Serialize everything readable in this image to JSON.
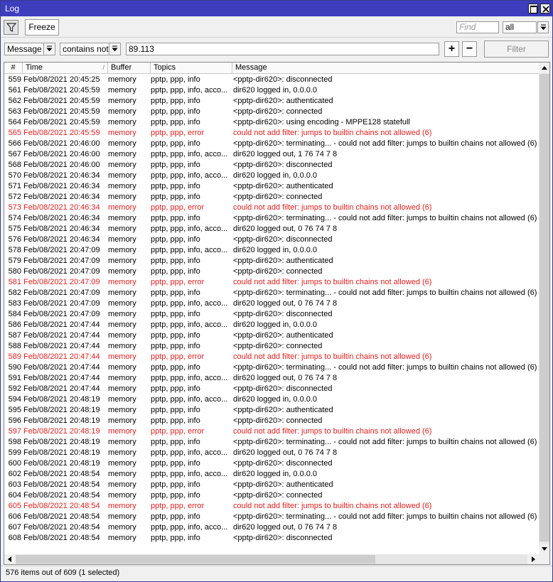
{
  "window": {
    "title": "Log"
  },
  "toolbar": {
    "freeze_label": "Freeze",
    "find_placeholder": "Find",
    "all_value": "all"
  },
  "filter": {
    "field": "Message",
    "operator": "contains not",
    "value": "89.113",
    "add_label": "+",
    "remove_label": "−",
    "filter_label": "Filter"
  },
  "columns": [
    "#",
    "Time",
    "Buffer",
    "Topics",
    "Message"
  ],
  "colors": {
    "error": "#e02020",
    "titlebar": "#3d3dbd"
  },
  "rows": [
    {
      "num": "559",
      "time": "Feb/08/2021 20:45:25",
      "buffer": "memory",
      "topics": "pptp, ppp, info",
      "message": "<pptp-dir620>: disconnected",
      "error": false
    },
    {
      "num": "561",
      "time": "Feb/08/2021 20:45:59",
      "buffer": "memory",
      "topics": "pptp, ppp, info, acco...",
      "message": "dir620 logged in, 0.0.0.0",
      "error": false
    },
    {
      "num": "562",
      "time": "Feb/08/2021 20:45:59",
      "buffer": "memory",
      "topics": "pptp, ppp, info",
      "message": "<pptp-dir620>: authenticated",
      "error": false
    },
    {
      "num": "563",
      "time": "Feb/08/2021 20:45:59",
      "buffer": "memory",
      "topics": "pptp, ppp, info",
      "message": "<pptp-dir620>: connected",
      "error": false
    },
    {
      "num": "564",
      "time": "Feb/08/2021 20:45:59",
      "buffer": "memory",
      "topics": "pptp, ppp, info",
      "message": "<pptp-dir620>: using encoding - MPPE128 statefull",
      "error": false
    },
    {
      "num": "565",
      "time": "Feb/08/2021 20:45:59",
      "buffer": "memory",
      "topics": "pptp, ppp, error",
      "message": "could not add filter: jumps to builtin chains not allowed (6)",
      "error": true
    },
    {
      "num": "566",
      "time": "Feb/08/2021 20:46:00",
      "buffer": "memory",
      "topics": "pptp, ppp, info",
      "message": "<pptp-dir620>: terminating... - could not add filter: jumps to builtin chains not allowed (6)",
      "error": false
    },
    {
      "num": "567",
      "time": "Feb/08/2021 20:46:00",
      "buffer": "memory",
      "topics": "pptp, ppp, info, acco...",
      "message": "dir620 logged out, 1 76 74 7 8",
      "error": false
    },
    {
      "num": "568",
      "time": "Feb/08/2021 20:46:00",
      "buffer": "memory",
      "topics": "pptp, ppp, info",
      "message": "<pptp-dir620>: disconnected",
      "error": false
    },
    {
      "num": "570",
      "time": "Feb/08/2021 20:46:34",
      "buffer": "memory",
      "topics": "pptp, ppp, info, acco...",
      "message": "dir620 logged in, 0.0.0.0",
      "error": false
    },
    {
      "num": "571",
      "time": "Feb/08/2021 20:46:34",
      "buffer": "memory",
      "topics": "pptp, ppp, info",
      "message": "<pptp-dir620>: authenticated",
      "error": false
    },
    {
      "num": "572",
      "time": "Feb/08/2021 20:46:34",
      "buffer": "memory",
      "topics": "pptp, ppp, info",
      "message": "<pptp-dir620>: connected",
      "error": false
    },
    {
      "num": "573",
      "time": "Feb/08/2021 20:46:34",
      "buffer": "memory",
      "topics": "pptp, ppp, error",
      "message": "could not add filter: jumps to builtin chains not allowed (6)",
      "error": true
    },
    {
      "num": "574",
      "time": "Feb/08/2021 20:46:34",
      "buffer": "memory",
      "topics": "pptp, ppp, info",
      "message": "<pptp-dir620>: terminating... - could not add filter: jumps to builtin chains not allowed (6)",
      "error": false
    },
    {
      "num": "575",
      "time": "Feb/08/2021 20:46:34",
      "buffer": "memory",
      "topics": "pptp, ppp, info, acco...",
      "message": "dir620 logged out, 0 76 74 7 8",
      "error": false
    },
    {
      "num": "576",
      "time": "Feb/08/2021 20:46:34",
      "buffer": "memory",
      "topics": "pptp, ppp, info",
      "message": "<pptp-dir620>: disconnected",
      "error": false
    },
    {
      "num": "578",
      "time": "Feb/08/2021 20:47:09",
      "buffer": "memory",
      "topics": "pptp, ppp, info, acco...",
      "message": "dir620 logged in, 0.0.0.0",
      "error": false
    },
    {
      "num": "579",
      "time": "Feb/08/2021 20:47:09",
      "buffer": "memory",
      "topics": "pptp, ppp, info",
      "message": "<pptp-dir620>: authenticated",
      "error": false
    },
    {
      "num": "580",
      "time": "Feb/08/2021 20:47:09",
      "buffer": "memory",
      "topics": "pptp, ppp, info",
      "message": "<pptp-dir620>: connected",
      "error": false
    },
    {
      "num": "581",
      "time": "Feb/08/2021 20:47:09",
      "buffer": "memory",
      "topics": "pptp, ppp, error",
      "message": "could not add filter: jumps to builtin chains not allowed (6)",
      "error": true
    },
    {
      "num": "582",
      "time": "Feb/08/2021 20:47:09",
      "buffer": "memory",
      "topics": "pptp, ppp, info",
      "message": "<pptp-dir620>: terminating... - could not add filter: jumps to builtin chains not allowed (6)",
      "error": false
    },
    {
      "num": "583",
      "time": "Feb/08/2021 20:47:09",
      "buffer": "memory",
      "topics": "pptp, ppp, info, acco...",
      "message": "dir620 logged out, 0 76 74 7 8",
      "error": false
    },
    {
      "num": "584",
      "time": "Feb/08/2021 20:47:09",
      "buffer": "memory",
      "topics": "pptp, ppp, info",
      "message": "<pptp-dir620>: disconnected",
      "error": false
    },
    {
      "num": "586",
      "time": "Feb/08/2021 20:47:44",
      "buffer": "memory",
      "topics": "pptp, ppp, info, acco...",
      "message": "dir620 logged in, 0.0.0.0",
      "error": false
    },
    {
      "num": "587",
      "time": "Feb/08/2021 20:47:44",
      "buffer": "memory",
      "topics": "pptp, ppp, info",
      "message": "<pptp-dir620>: authenticated",
      "error": false
    },
    {
      "num": "588",
      "time": "Feb/08/2021 20:47:44",
      "buffer": "memory",
      "topics": "pptp, ppp, info",
      "message": "<pptp-dir620>: connected",
      "error": false
    },
    {
      "num": "589",
      "time": "Feb/08/2021 20:47:44",
      "buffer": "memory",
      "topics": "pptp, ppp, error",
      "message": "could not add filter: jumps to builtin chains not allowed (6)",
      "error": true
    },
    {
      "num": "590",
      "time": "Feb/08/2021 20:47:44",
      "buffer": "memory",
      "topics": "pptp, ppp, info",
      "message": "<pptp-dir620>: terminating... - could not add filter: jumps to builtin chains not allowed (6)",
      "error": false
    },
    {
      "num": "591",
      "time": "Feb/08/2021 20:47:44",
      "buffer": "memory",
      "topics": "pptp, ppp, info, acco...",
      "message": "dir620 logged out, 0 76 74 7 8",
      "error": false
    },
    {
      "num": "592",
      "time": "Feb/08/2021 20:47:44",
      "buffer": "memory",
      "topics": "pptp, ppp, info",
      "message": "<pptp-dir620>: disconnected",
      "error": false
    },
    {
      "num": "594",
      "time": "Feb/08/2021 20:48:19",
      "buffer": "memory",
      "topics": "pptp, ppp, info, acco...",
      "message": "dir620 logged in, 0.0.0.0",
      "error": false
    },
    {
      "num": "595",
      "time": "Feb/08/2021 20:48:19",
      "buffer": "memory",
      "topics": "pptp, ppp, info",
      "message": "<pptp-dir620>: authenticated",
      "error": false
    },
    {
      "num": "596",
      "time": "Feb/08/2021 20:48:19",
      "buffer": "memory",
      "topics": "pptp, ppp, info",
      "message": "<pptp-dir620>: connected",
      "error": false
    },
    {
      "num": "597",
      "time": "Feb/08/2021 20:48:19",
      "buffer": "memory",
      "topics": "pptp, ppp, error",
      "message": "could not add filter: jumps to builtin chains not allowed (6)",
      "error": true
    },
    {
      "num": "598",
      "time": "Feb/08/2021 20:48:19",
      "buffer": "memory",
      "topics": "pptp, ppp, info",
      "message": "<pptp-dir620>: terminating... - could not add filter: jumps to builtin chains not allowed (6)",
      "error": false
    },
    {
      "num": "599",
      "time": "Feb/08/2021 20:48:19",
      "buffer": "memory",
      "topics": "pptp, ppp, info, acco...",
      "message": "dir620 logged out, 0 76 74 7 8",
      "error": false
    },
    {
      "num": "600",
      "time": "Feb/08/2021 20:48:19",
      "buffer": "memory",
      "topics": "pptp, ppp, info",
      "message": "<pptp-dir620>: disconnected",
      "error": false
    },
    {
      "num": "602",
      "time": "Feb/08/2021 20:48:54",
      "buffer": "memory",
      "topics": "pptp, ppp, info, acco...",
      "message": "dir620 logged in, 0.0.0.0",
      "error": false
    },
    {
      "num": "603",
      "time": "Feb/08/2021 20:48:54",
      "buffer": "memory",
      "topics": "pptp, ppp, info",
      "message": "<pptp-dir620>: authenticated",
      "error": false
    },
    {
      "num": "604",
      "time": "Feb/08/2021 20:48:54",
      "buffer": "memory",
      "topics": "pptp, ppp, info",
      "message": "<pptp-dir620>: connected",
      "error": false
    },
    {
      "num": "605",
      "time": "Feb/08/2021 20:48:54",
      "buffer": "memory",
      "topics": "pptp, ppp, error",
      "message": "could not add filter: jumps to builtin chains not allowed (6)",
      "error": true
    },
    {
      "num": "606",
      "time": "Feb/08/2021 20:48:54",
      "buffer": "memory",
      "topics": "pptp, ppp, info",
      "message": "<pptp-dir620>: terminating... - could not add filter: jumps to builtin chains not allowed (6)",
      "error": false
    },
    {
      "num": "607",
      "time": "Feb/08/2021 20:48:54",
      "buffer": "memory",
      "topics": "pptp, ppp, info, acco...",
      "message": "dir620 logged out, 0 76 74 7 8",
      "error": false
    },
    {
      "num": "608",
      "time": "Feb/08/2021 20:48:54",
      "buffer": "memory",
      "topics": "pptp, ppp, info",
      "message": "<pptp-dir620>: disconnected",
      "error": false
    }
  ],
  "status": {
    "text": "576 items out of 609 (1 selected)"
  }
}
